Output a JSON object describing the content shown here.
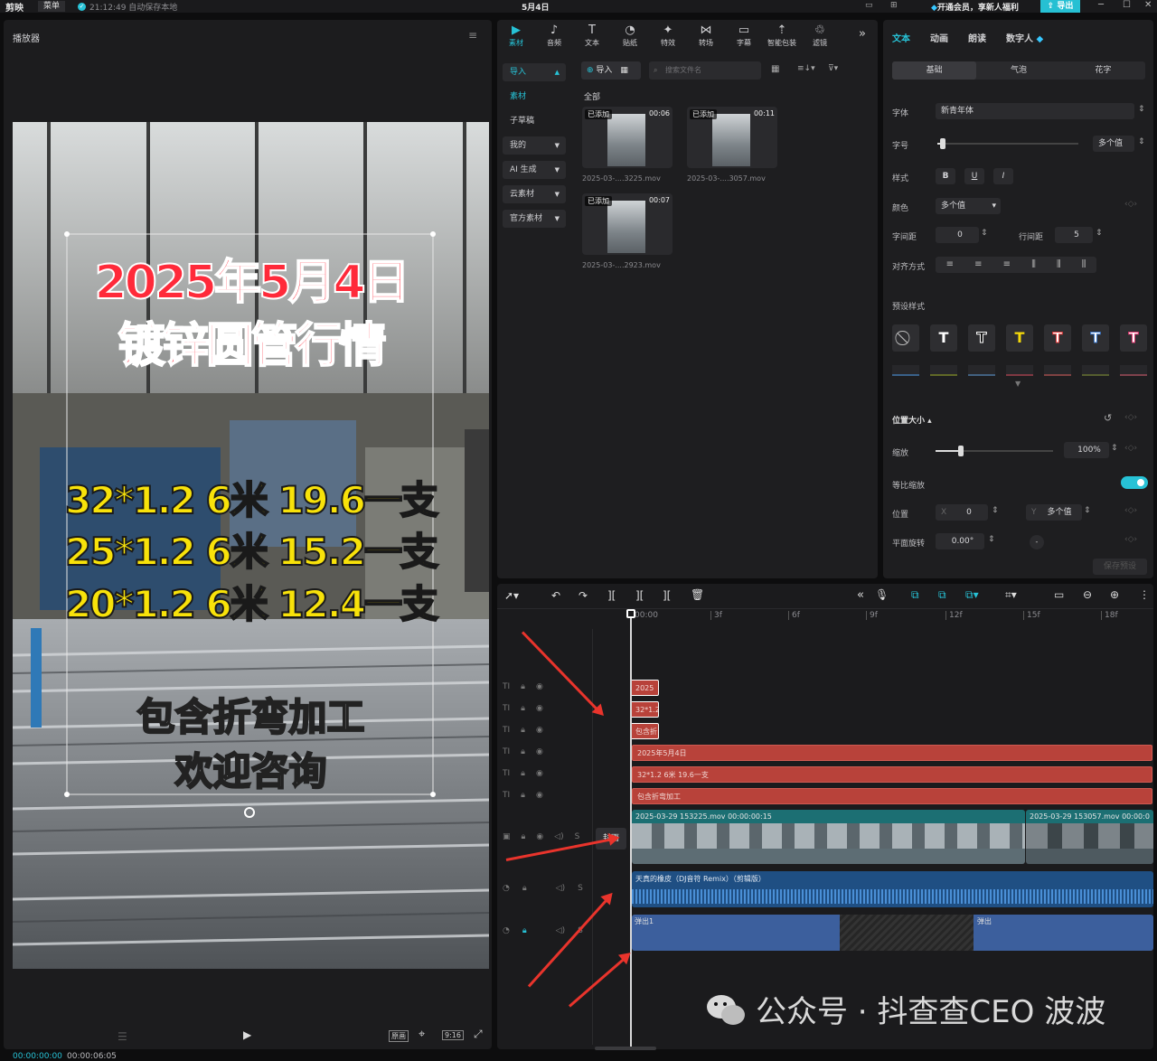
{
  "app": {
    "name": "剪映",
    "menu": "菜单",
    "autosave": "21:12:49 自动保存本地",
    "project": "5月4日",
    "vip": "开通会员，享新人福利",
    "export": "导出"
  },
  "player": {
    "title": "播放器",
    "captions": {
      "title1": "2025年5月4日",
      "title2": "镀锌圆管行情",
      "price1": "32*1.2 6米 19.6一支",
      "price2": "25*1.2 6米 15.2一支",
      "price3": "20*1.2 6米 12.4一支",
      "note1": "包含折弯加工",
      "note2": "欢迎咨询"
    },
    "time_current": "00:00:00:00",
    "time_total": "00:00:06:05",
    "ratio": "9:16",
    "original": "原画"
  },
  "media": {
    "tabs": [
      {
        "label": "素材",
        "icon": "media-icon"
      },
      {
        "label": "音频",
        "icon": "audio-icon"
      },
      {
        "label": "文本",
        "icon": "text-icon"
      },
      {
        "label": "贴纸",
        "icon": "sticker-icon"
      },
      {
        "label": "特效",
        "icon": "effect-icon"
      },
      {
        "label": "转场",
        "icon": "transition-icon"
      },
      {
        "label": "字幕",
        "icon": "subtitle-icon"
      },
      {
        "label": "智能包装",
        "icon": "smart-pack-icon"
      },
      {
        "label": "滤镜",
        "icon": "filter-icon"
      }
    ],
    "nav": [
      {
        "label": "导入"
      },
      {
        "label": "素材"
      },
      {
        "label": "子草稿"
      },
      {
        "label": "我的"
      },
      {
        "label": "AI 生成"
      },
      {
        "label": "云素材"
      },
      {
        "label": "官方素材"
      }
    ],
    "import_btn": "导入",
    "search_placeholder": "搜索文件名",
    "filter_all": "全部",
    "clips": [
      {
        "badge": "已添加",
        "duration": "00:06",
        "name": "2025-03-....3225.mov"
      },
      {
        "badge": "已添加",
        "duration": "00:11",
        "name": "2025-03-....3057.mov"
      },
      {
        "badge": "已添加",
        "duration": "00:07",
        "name": "2025-03-....2923.mov"
      }
    ]
  },
  "props": {
    "tabs": [
      "文本",
      "动画",
      "朗读",
      "数字人"
    ],
    "sub_tabs": [
      "基础",
      "气泡",
      "花字"
    ],
    "font_label": "字体",
    "font_value": "新青年体",
    "size_label": "字号",
    "size_value": "多个值",
    "style_label": "样式",
    "style_buttons": [
      "B",
      "U",
      "I"
    ],
    "color_label": "颜色",
    "color_value": "多个值",
    "spacing_label": "字间距",
    "spacing_value": "0",
    "line_label": "行间距",
    "line_value": "5",
    "align_label": "对齐方式",
    "preset_label": "预设样式",
    "pos_size_label": "位置大小",
    "scale_label": "缩放",
    "scale_value": "100%",
    "ratio_label": "等比缩放",
    "position_label": "位置",
    "pos_x_label": "X",
    "pos_x": "0",
    "pos_y_label": "Y",
    "pos_y": "多个值",
    "rotate_label": "平面旋转",
    "rotate_value": "0.00°",
    "save_preset": "保存预设"
  },
  "timeline": {
    "ticks": [
      "00:00",
      "3f",
      "6f",
      "9f",
      "12f",
      "15f",
      "18f"
    ],
    "short_clips": [
      "2025",
      "32*1.2",
      "包含折"
    ],
    "text_clips": [
      "2025年5月4日",
      "32*1.2  6米  19.6一支",
      "包含折弯加工"
    ],
    "video_clip1": "2025-03-29 153225.mov  00:00:00:15",
    "video_clip2": "2025-03-29 153057.mov  00:00:0",
    "cover": "封面",
    "audio_clip": "天真的橡皮（DJ音符 Remix）（剪辑版）",
    "sfx_label": "弹出1",
    "sfx2_label": "弹出"
  },
  "watermark": "公众号 · 抖查查CEO 波波"
}
